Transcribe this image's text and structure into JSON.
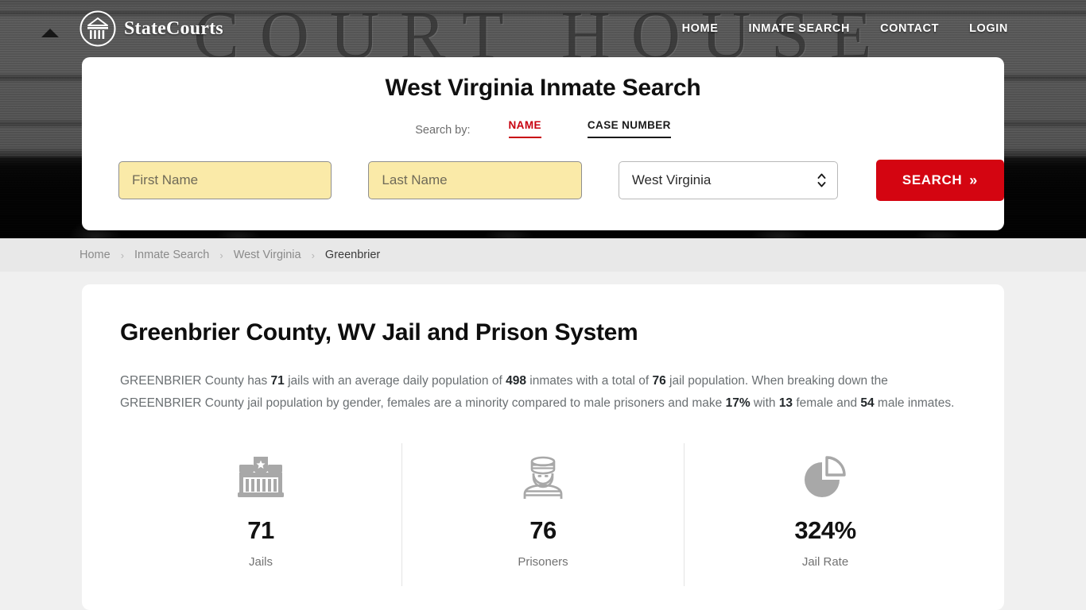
{
  "brand": {
    "name": "StateCourts",
    "logo_icon": "courthouse-circle-icon"
  },
  "nav": {
    "items": [
      {
        "label": "HOME"
      },
      {
        "label": "INMATE SEARCH"
      },
      {
        "label": "CONTACT"
      },
      {
        "label": "LOGIN"
      }
    ]
  },
  "search": {
    "title": "West Virginia Inmate Search",
    "search_by_label": "Search by:",
    "tabs": [
      {
        "label": "NAME",
        "active": true
      },
      {
        "label": "CASE NUMBER",
        "active": false
      }
    ],
    "first_name_placeholder": "First Name",
    "first_name_value": "",
    "last_name_placeholder": "Last Name",
    "last_name_value": "",
    "state_selected": "West Virginia",
    "submit_label": "SEARCH",
    "submit_chevron": "»",
    "accent_color": "#d40511",
    "field_fill_color": "#faeaa8"
  },
  "breadcrumb": {
    "items": [
      {
        "label": "Home"
      },
      {
        "label": "Inmate Search"
      },
      {
        "label": "West Virginia"
      },
      {
        "label": "Greenbrier"
      }
    ],
    "separator": "›"
  },
  "main": {
    "title": "Greenbrier County, WV Jail and Prison System",
    "intro": {
      "p1": "GREENBRIER County has ",
      "jails": "71",
      "p2": " jails with an average daily population of ",
      "avg_daily_population": "498",
      "p3": " inmates with a total of ",
      "total_jail_population": "76",
      "p4": " jail population. When breaking down the GREENBRIER County jail population by gender, females are a minority compared to male prisoners and make ",
      "female_percent": "17%",
      "p5": " with ",
      "female_count": "13",
      "p6": " female and ",
      "male_count": "54",
      "p7": " male inmates."
    },
    "stats": [
      {
        "icon": "jail-building-icon",
        "value": "71",
        "label": "Jails"
      },
      {
        "icon": "prisoner-icon",
        "value": "76",
        "label": "Prisoners"
      },
      {
        "icon": "pie-chart-icon",
        "value": "324%",
        "label": "Jail Rate"
      }
    ]
  },
  "hero": {
    "background_text": "COURT HOUSE"
  }
}
